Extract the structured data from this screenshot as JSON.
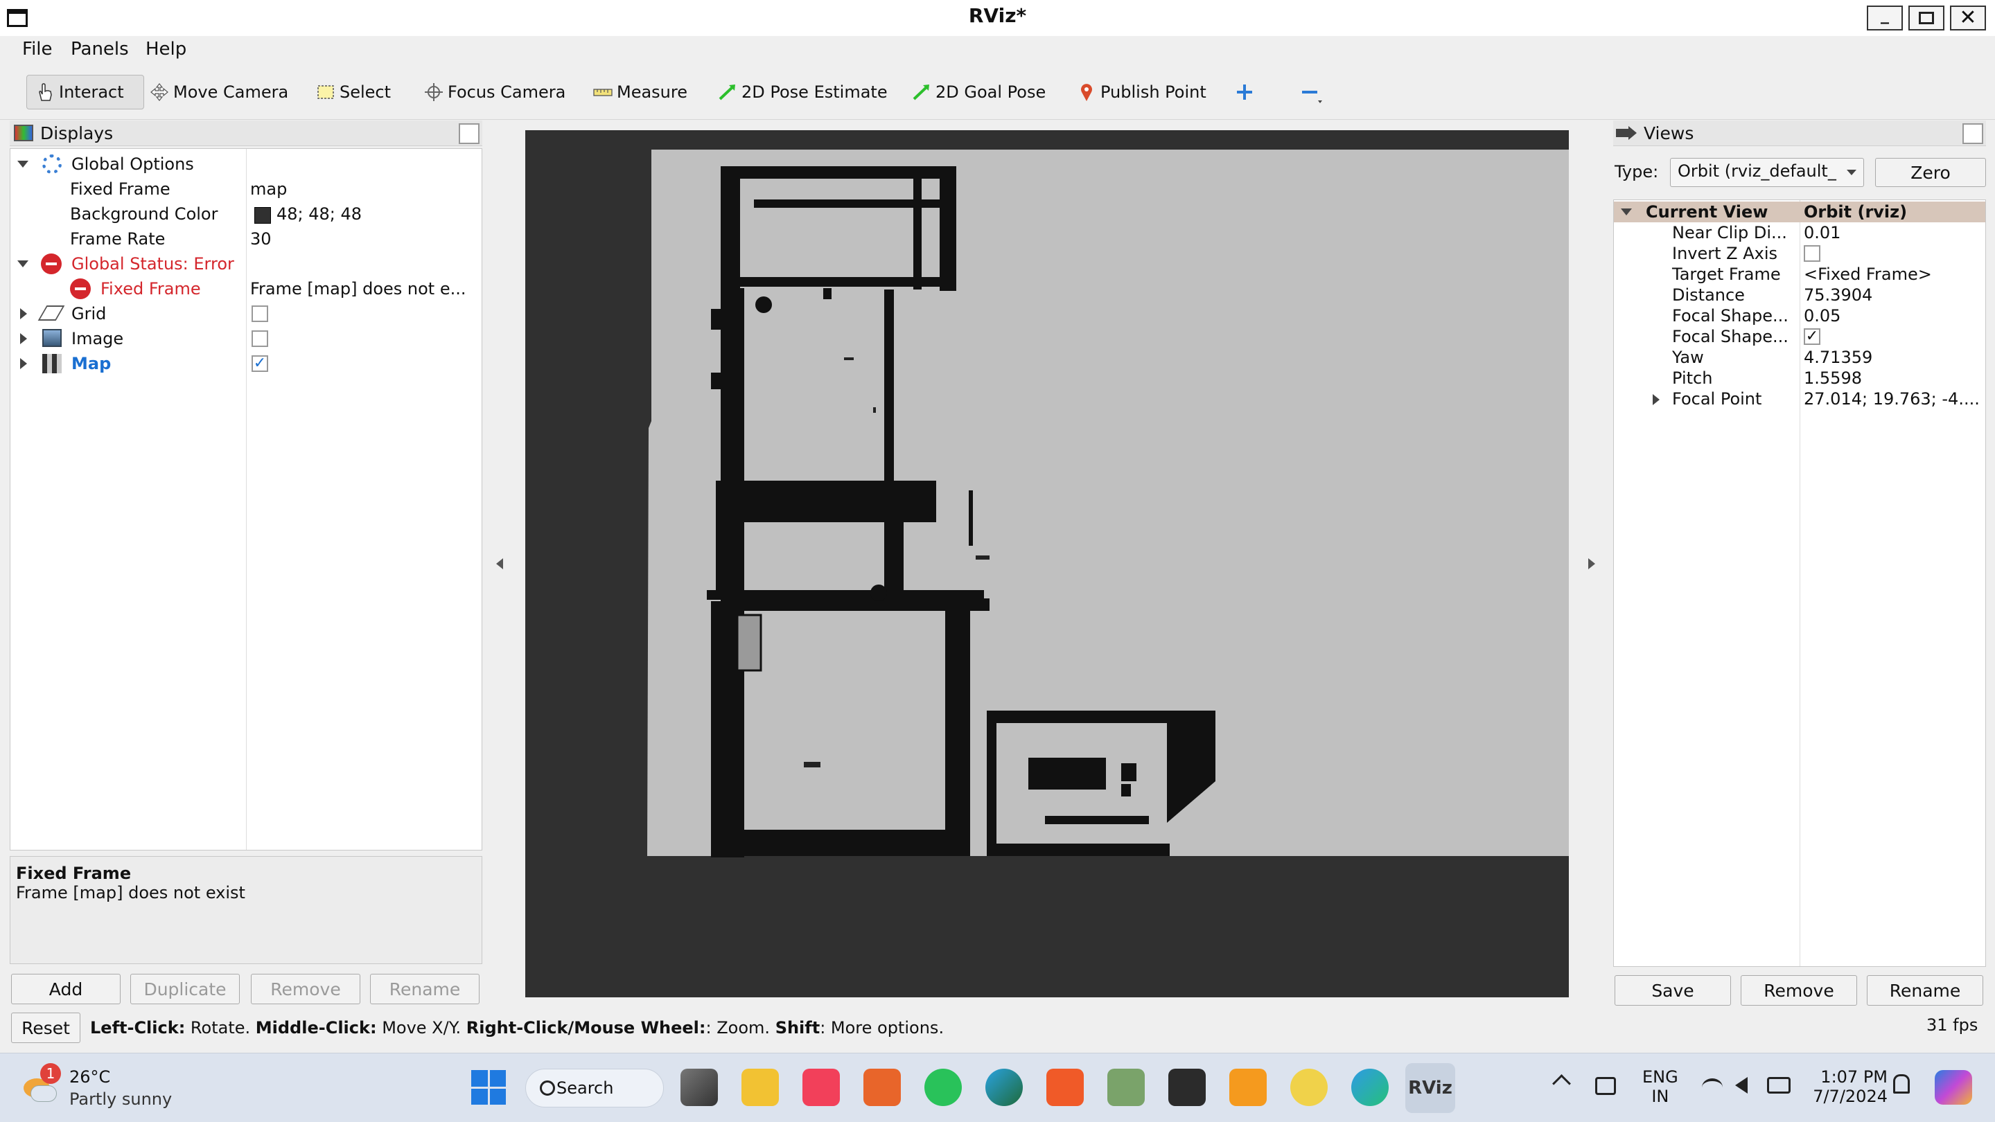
{
  "window": {
    "title": "RViz*"
  },
  "menu": [
    "File",
    "Panels",
    "Help"
  ],
  "toolbar": {
    "interact": "Interact",
    "move_camera": "Move Camera",
    "select": "Select",
    "focus_camera": "Focus Camera",
    "measure": "Measure",
    "pose_estimate": "2D Pose Estimate",
    "goal_pose": "2D Goal Pose",
    "publish_point": "Publish Point"
  },
  "displays": {
    "title": "Displays",
    "rows": {
      "global_options": "Global Options",
      "fixed_frame_label": "Fixed Frame",
      "fixed_frame_value": "map",
      "bg_color_label": "Background Color",
      "bg_color_value": "48; 48; 48",
      "frame_rate_label": "Frame Rate",
      "frame_rate_value": "30",
      "global_status": "Global Status: Error",
      "fixed_frame_err_label": "Fixed Frame",
      "fixed_frame_err_value": "Frame [map] does not e...",
      "grid": "Grid",
      "image": "Image",
      "map": "Map"
    },
    "desc_title": "Fixed Frame",
    "desc_text": "Frame [map] does not exist",
    "buttons": {
      "add": "Add",
      "duplicate": "Duplicate",
      "remove": "Remove",
      "rename": "Rename"
    }
  },
  "views": {
    "title": "Views",
    "type_label": "Type:",
    "type_value": "Orbit (rviz_default_",
    "zero": "Zero",
    "current_view_label": "Current View",
    "current_view_value": "Orbit (rviz)",
    "props": [
      {
        "name": "Near Clip Di...",
        "value": "0.01"
      },
      {
        "name": "Invert Z Axis",
        "value": ""
      },
      {
        "name": "Target Frame",
        "value": "<Fixed Frame>"
      },
      {
        "name": "Distance",
        "value": "75.3904"
      },
      {
        "name": "Focal Shape...",
        "value": "0.05"
      },
      {
        "name": "Focal Shape...",
        "value": ""
      },
      {
        "name": "Yaw",
        "value": "4.71359"
      },
      {
        "name": "Pitch",
        "value": "1.5598"
      },
      {
        "name": "Focal Point",
        "value": "27.014; 19.763; -4...."
      }
    ],
    "buttons": {
      "save": "Save",
      "remove": "Remove",
      "rename": "Rename"
    }
  },
  "status": {
    "reset": "Reset",
    "k1": "Left-Click:",
    "t1": " Rotate. ",
    "k2": "Middle-Click:",
    "t2": " Move X/Y. ",
    "k3": "Right-Click/Mouse Wheel:",
    "t3": ": Zoom. ",
    "k4": "Shift",
    "t4": ": More options.",
    "fps": "31 fps"
  },
  "taskbar": {
    "temp": "26°C",
    "weather": "Partly sunny",
    "weather_badge": "1",
    "search": "Search",
    "lang1": "ENG",
    "lang2": "IN",
    "time": "1:07 PM",
    "date": "7/7/2024"
  },
  "colors": {
    "accent": "#1a6fd1",
    "error": "#d4262c",
    "viewport_bg": "#303030",
    "map_free": "#c0c0c0"
  }
}
